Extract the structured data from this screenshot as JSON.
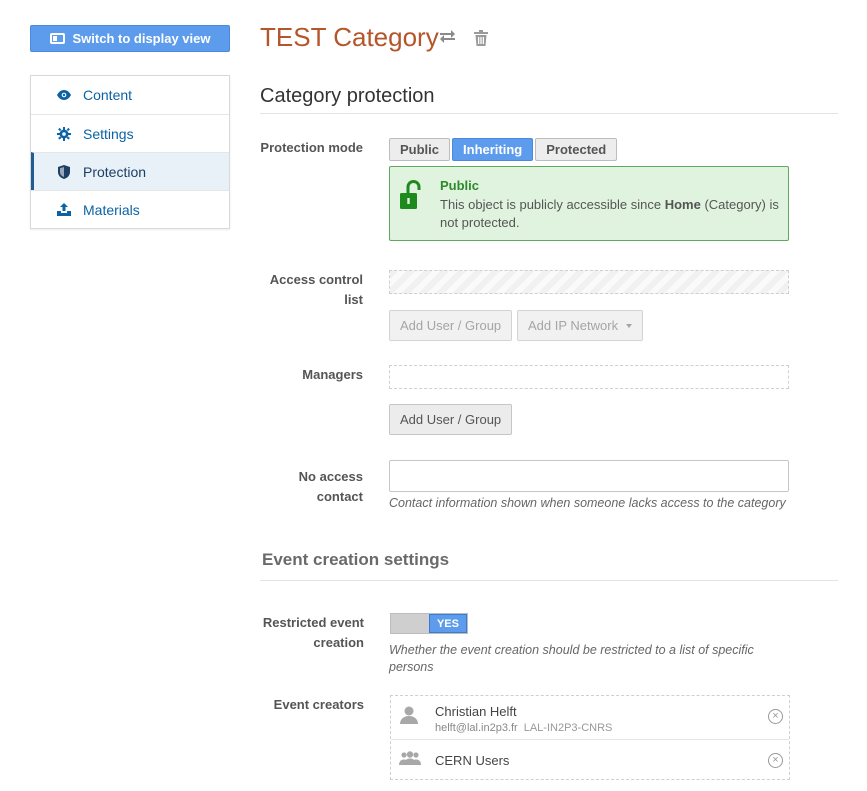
{
  "sidebar": {
    "switch_label": "Switch to display view",
    "items": [
      {
        "label": "Content",
        "icon": "eye-icon"
      },
      {
        "label": "Settings",
        "icon": "gear-icon"
      },
      {
        "label": "Protection",
        "icon": "shield-icon",
        "active": true
      },
      {
        "label": "Materials",
        "icon": "upload-icon"
      }
    ]
  },
  "header": {
    "title": "TEST Category",
    "icons": [
      "transfer-icon",
      "trash-icon"
    ]
  },
  "protection": {
    "section_title": "Category protection",
    "mode_label": "Protection mode",
    "modes": [
      "Public",
      "Inheriting",
      "Protected"
    ],
    "selected_mode": "Inheriting",
    "notice": {
      "title": "Public",
      "text_before": "This object is publicly accessible since ",
      "text_bold": "Home",
      "text_after": " (Category) is not protected."
    },
    "acl_label": "Access control list",
    "acl_add_user": "Add User / Group",
    "acl_add_ip": "Add IP Network",
    "managers_label": "Managers",
    "managers_add_user": "Add User / Group",
    "no_access_label": "No access contact",
    "no_access_value": "",
    "no_access_help": "Contact information shown when someone lacks access to the category"
  },
  "event_creation": {
    "title": "Event creation settings",
    "restricted_label": "Restricted event creation",
    "restricted_value": "YES",
    "restricted_help": "Whether the event creation should be restricted to a list of specific persons",
    "creators_label": "Event creators",
    "creators": [
      {
        "name": "Christian Helft",
        "email": "helft@lal.in2p3.fr",
        "affiliation": "LAL-IN2P3-CNRS",
        "icon": "user-icon"
      },
      {
        "name": "CERN Users",
        "icon": "group-icon"
      }
    ]
  },
  "colors": {
    "primary": "#5d9cec",
    "title": "#b5552a",
    "link": "#0b63a5",
    "success_bg": "#dff3df",
    "success_border": "#5fa85f"
  }
}
